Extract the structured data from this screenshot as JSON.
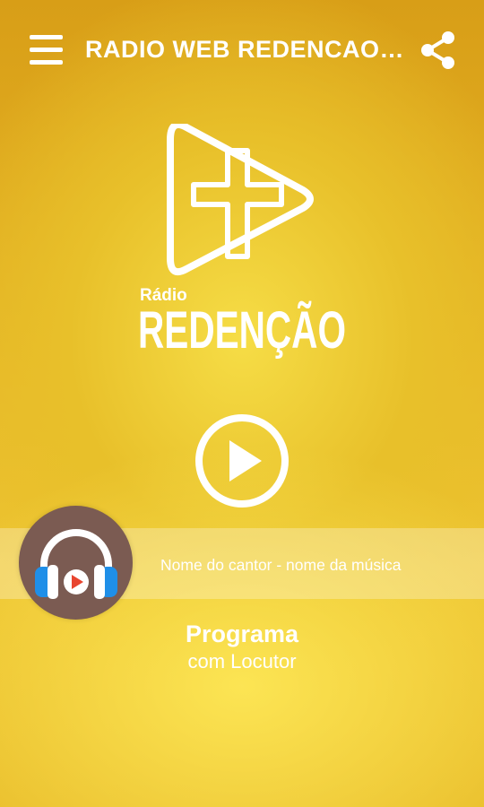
{
  "app": {
    "title": "RADIO WEB REDENCAO DE PALHOÇA",
    "menu_icon": "hamburger-menu-icon",
    "share_icon": "share-icon"
  },
  "logo": {
    "small_text": "Rádio",
    "big_text": "REDENÇÃO"
  },
  "player": {
    "play_icon": "play-circle-icon",
    "track": "Nome do cantor - nome da música",
    "avatar_icon": "headphones-icon"
  },
  "program": {
    "name": "Programa",
    "host": "com Locutor"
  },
  "colors": {
    "background": "#e8bd2a",
    "avatar": "#7b5b52",
    "headphones": "#1f8fe8",
    "play_mini": "#e8452f"
  }
}
